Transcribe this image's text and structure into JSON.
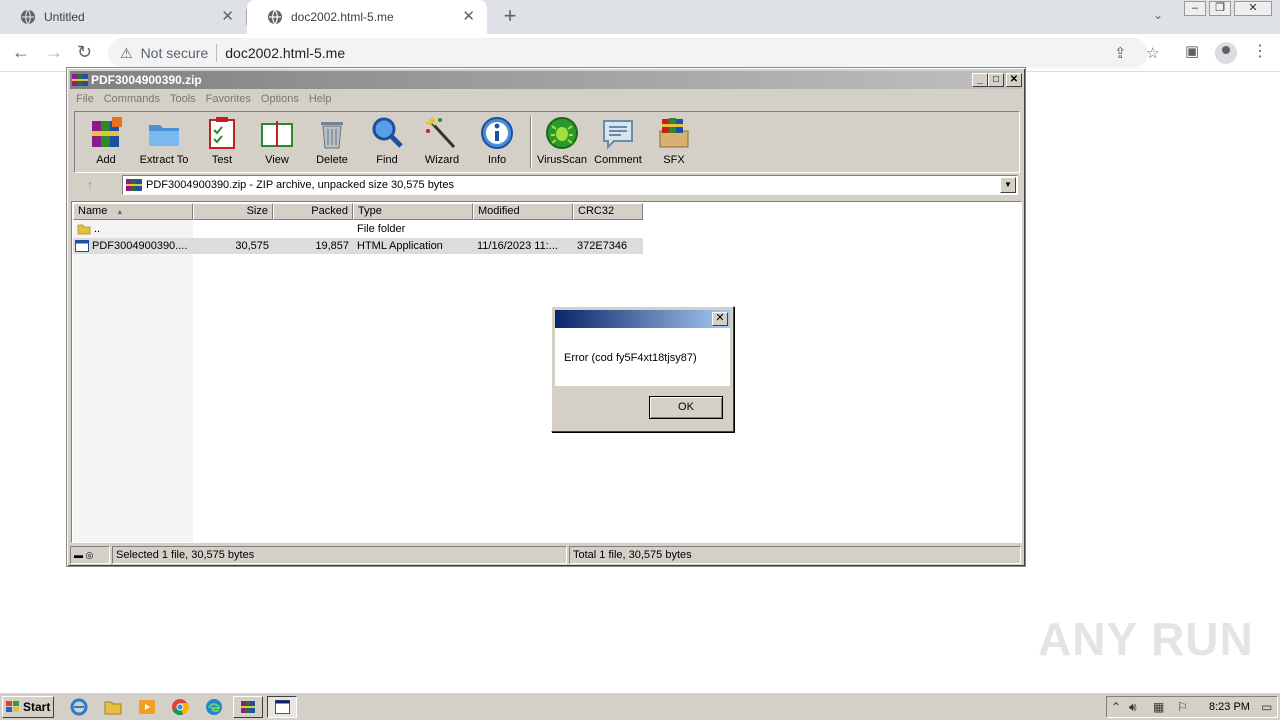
{
  "browser": {
    "tabs": [
      {
        "title": "Untitled"
      },
      {
        "title": "doc2002.html-5.me"
      }
    ],
    "security_label": "Not secure",
    "url": "doc2002.html-5.me"
  },
  "winrar": {
    "title": "PDF3004900390.zip",
    "menu": [
      "File",
      "Commands",
      "Tools",
      "Favorites",
      "Options",
      "Help"
    ],
    "tools": [
      {
        "label": "Add",
        "icon": "add-icon"
      },
      {
        "label": "Extract To",
        "icon": "extract-to-icon"
      },
      {
        "label": "Test",
        "icon": "test-icon"
      },
      {
        "label": "View",
        "icon": "view-icon"
      },
      {
        "label": "Delete",
        "icon": "delete-icon"
      },
      {
        "label": "Find",
        "icon": "find-icon"
      },
      {
        "label": "Wizard",
        "icon": "wizard-icon"
      },
      {
        "label": "Info",
        "icon": "info-icon"
      },
      {
        "label": "VirusScan",
        "icon": "virusscan-icon"
      },
      {
        "label": "Comment",
        "icon": "comment-icon"
      },
      {
        "label": "SFX",
        "icon": "sfx-icon"
      }
    ],
    "path": "PDF3004900390.zip - ZIP archive, unpacked size 30,575 bytes",
    "columns": [
      "Name",
      "Size",
      "Packed",
      "Type",
      "Modified",
      "CRC32"
    ],
    "files": [
      {
        "name": "..",
        "size": "",
        "packed": "",
        "type": "File folder",
        "modified": "",
        "crc": ""
      },
      {
        "name": "PDF3004900390....",
        "size": "30,575",
        "packed": "19,857",
        "type": "HTML Application",
        "modified": "11/16/2023 11:...",
        "crc": "372E7346"
      }
    ],
    "status_left": "Selected 1 file, 30,575 bytes",
    "status_right": "Total 1 file, 30,575 bytes"
  },
  "dialog": {
    "message": "Error (cod fy5F4xt18tjsy87)",
    "ok_label": "OK"
  },
  "watermark": "ANY RUN",
  "taskbar": {
    "start_label": "Start",
    "clock": "8:23 PM"
  }
}
